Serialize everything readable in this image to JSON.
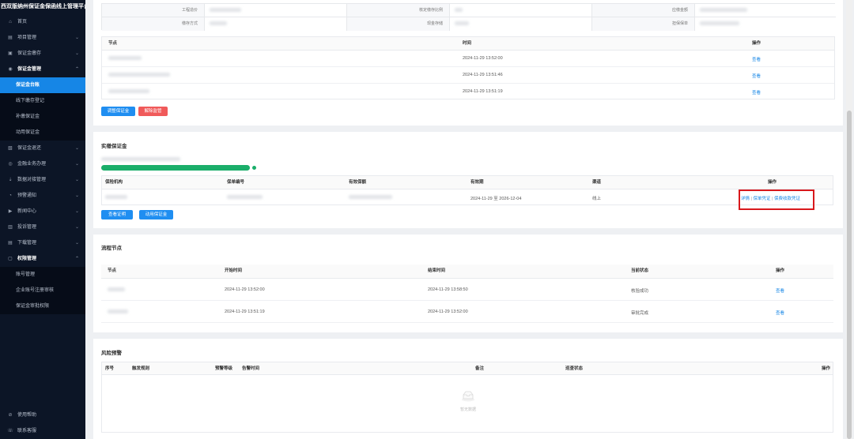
{
  "app": {
    "title": "西双版纳州保证金保函线上管理平台"
  },
  "sidebar": {
    "items": [
      {
        "label": "首页",
        "icon": "home-icon",
        "glyph": "⌂"
      },
      {
        "label": "项目管理",
        "icon": "folder-icon",
        "glyph": "▤",
        "chevron": "⌄"
      },
      {
        "label": "保证金缴存",
        "icon": "wallet-icon",
        "glyph": "▣",
        "chevron": "⌄"
      },
      {
        "label": "保证金管理",
        "icon": "shield-icon",
        "glyph": "◉",
        "chevron": "⌃",
        "open": true
      }
    ],
    "sub_items_1": [
      {
        "label": "保证金台账",
        "active": true
      },
      {
        "label": "线下缴存登记"
      },
      {
        "label": "补缴保证金"
      },
      {
        "label": "动用保证金"
      }
    ],
    "items_2": [
      {
        "label": "保证金退还",
        "icon": "return-icon",
        "glyph": "▧",
        "chevron": "⌄"
      },
      {
        "label": "金融业务办理",
        "icon": "finance-icon",
        "glyph": "◎",
        "chevron": "⌄"
      },
      {
        "label": "数据对接管理",
        "icon": "data-icon",
        "glyph": "⇣",
        "chevron": "⌄"
      },
      {
        "label": "预警通知",
        "icon": "bell-icon",
        "glyph": "◔",
        "chevron": "⌄"
      },
      {
        "label": "新闻中心",
        "icon": "news-icon",
        "glyph": "▶",
        "chevron": "⌄"
      },
      {
        "label": "投诉管理",
        "icon": "complaint-icon",
        "glyph": "▥",
        "chevron": "⌄"
      },
      {
        "label": "下载管理",
        "icon": "download-icon",
        "glyph": "▤",
        "chevron": "⌄"
      },
      {
        "label": "权限管理",
        "icon": "lock-icon",
        "glyph": "▢",
        "chevron": "⌃",
        "open": true
      }
    ],
    "sub_items_2": [
      {
        "label": "账号管理"
      },
      {
        "label": "企业账号注册审核"
      },
      {
        "label": "保证金审批权限"
      }
    ],
    "bottom": [
      {
        "label": "使用帮助",
        "icon": "help-icon",
        "glyph": "⊘"
      },
      {
        "label": "联系客服",
        "icon": "service-icon",
        "glyph": "☏"
      }
    ]
  },
  "info_grid": {
    "labels": [
      "工程造价",
      "核定缴存比例",
      "应缴金额",
      "缴存方式",
      "现金存储",
      "担保保单"
    ]
  },
  "nodes_table": {
    "headers": [
      "节点",
      "时间",
      "操作"
    ],
    "rows": [
      {
        "time": "2024-11-29 13:52:00",
        "action": "查看"
      },
      {
        "time": "2024-11-29 13:51:46",
        "action": "查看"
      },
      {
        "time": "2024-11-29 13:51:19",
        "action": "查看"
      }
    ],
    "buttons": {
      "adjust": "调整保证金",
      "release": "解除监管"
    }
  },
  "paid": {
    "title": "实缴保证金",
    "headers": [
      "保险机构",
      "保单编号",
      "有效保额",
      "有效期",
      "渠道",
      "操作"
    ],
    "row": {
      "period": "2024-11-29 至 2026-12-04",
      "channel": "线上",
      "actions": [
        "详情",
        "保单凭证",
        "保费收款凭证"
      ],
      "separator": "|"
    },
    "buttons": {
      "proof": "查看证明",
      "use": "动用保证金"
    }
  },
  "process": {
    "title": "流程节点",
    "headers": [
      "节点",
      "开始时间",
      "结束时间",
      "当前状态",
      "操作"
    ],
    "rows": [
      {
        "start": "2024-11-29 13:52:00",
        "end": "2024-11-29 13:58:50",
        "status": "核验成功",
        "action": "查看"
      },
      {
        "start": "2024-11-29 13:51:19",
        "end": "2024-11-29 13:52:00",
        "status": "审批完成",
        "action": "查看"
      }
    ]
  },
  "risk": {
    "title": "风险预警",
    "headers": [
      "序号",
      "触发规则",
      "预警等级",
      "告警时间",
      "备注",
      "巡查状态",
      "操作"
    ],
    "empty_text": "暂无数据"
  },
  "colors": {
    "sidebar_bg": "#0c1526",
    "accent": "#1686e6",
    "danger": "#f05a5a",
    "success": "#1aae6a",
    "highlight": "#d8181c"
  }
}
